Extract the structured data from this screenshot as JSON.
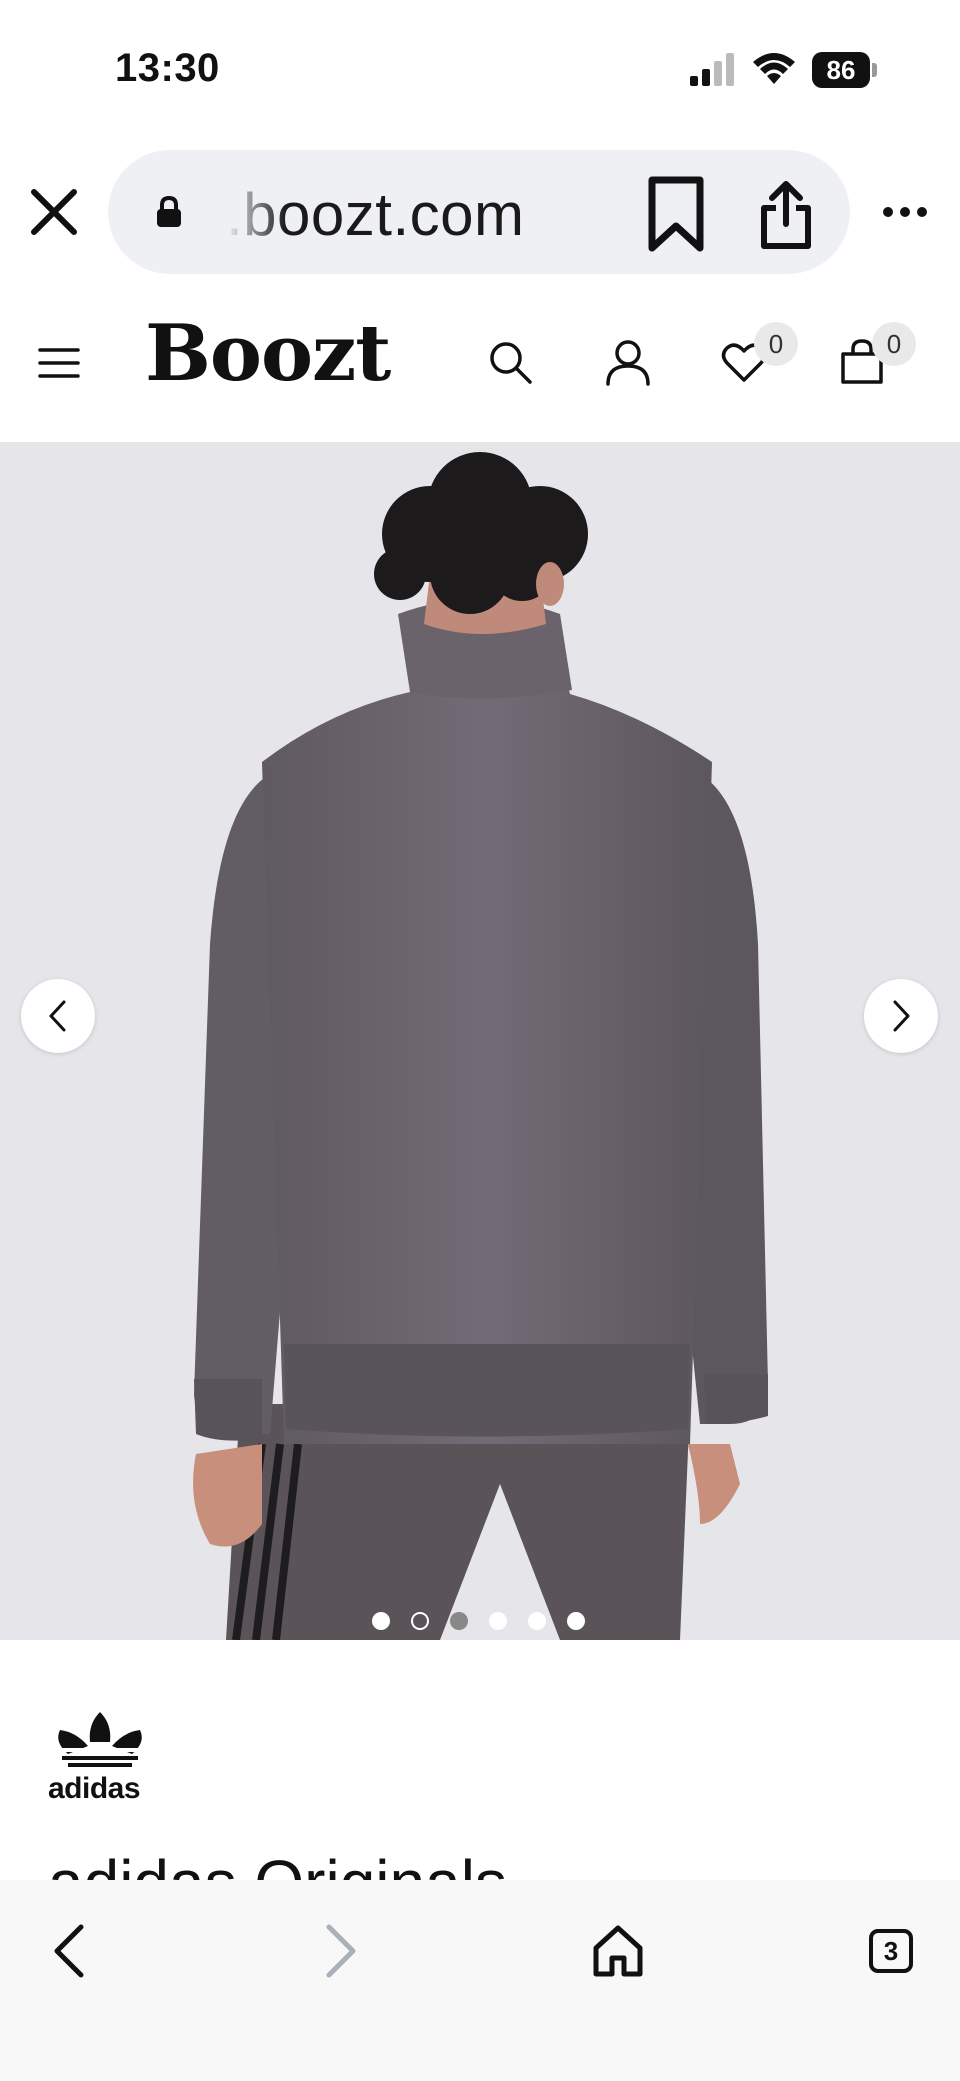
{
  "status_bar": {
    "time": "13:30",
    "battery": "86"
  },
  "browser": {
    "url": ".boozt.com",
    "bottom_tab_count": "3"
  },
  "site": {
    "logo": "Boozt",
    "wishlist_count": "0",
    "cart_count": "0"
  },
  "gallery": {
    "total_images": 6,
    "active_index": 2
  },
  "product": {
    "brand_logo_text": "adidas",
    "title": "adidas Originals"
  },
  "icons": [
    "close-icon",
    "lock-icon",
    "bookmark-icon",
    "share-icon",
    "more-icon",
    "hamburger-icon",
    "search-icon",
    "user-icon",
    "heart-icon",
    "bag-icon",
    "chevron-left-icon",
    "chevron-right-icon",
    "back-icon",
    "forward-icon",
    "home-icon",
    "tabs-icon"
  ],
  "colors": {
    "image_background": "#e6e5ea",
    "jacket": "#6e6770",
    "toolbar": "#f8f8f8"
  }
}
